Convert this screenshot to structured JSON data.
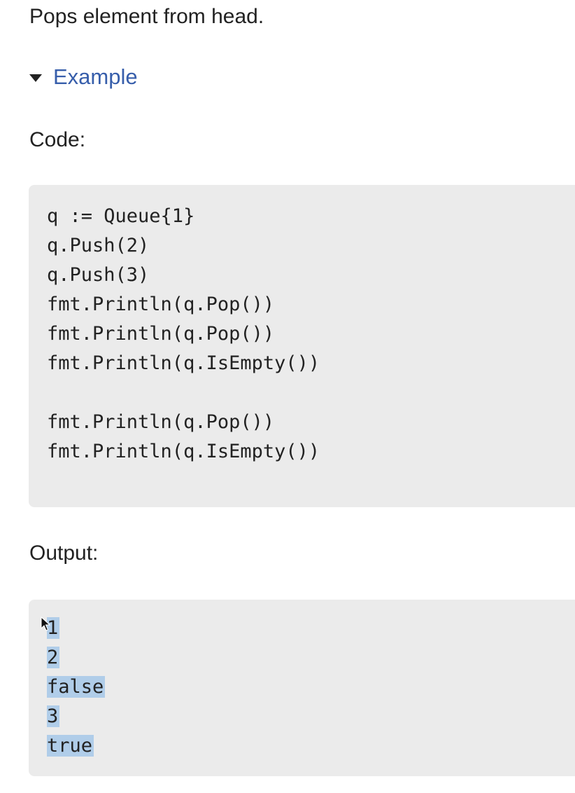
{
  "description": "Pops element from head.",
  "example_toggle": {
    "label": "Example",
    "expanded": true,
    "icon": "caret-down-icon"
  },
  "code_section": {
    "label": "Code:",
    "lines": [
      "q := Queue{1}",
      "q.Push(2)",
      "q.Push(3)",
      "fmt.Println(q.Pop())",
      "fmt.Println(q.Pop())",
      "fmt.Println(q.IsEmpty())",
      "",
      "fmt.Println(q.Pop())",
      "fmt.Println(q.IsEmpty())"
    ]
  },
  "output_section": {
    "label": "Output:",
    "lines": [
      "1",
      "2",
      "false",
      "3",
      "true"
    ],
    "selection_color": "#b0cde9"
  },
  "colors": {
    "link": "#375eab",
    "code_background": "#ebebeb",
    "text": "#222222"
  }
}
